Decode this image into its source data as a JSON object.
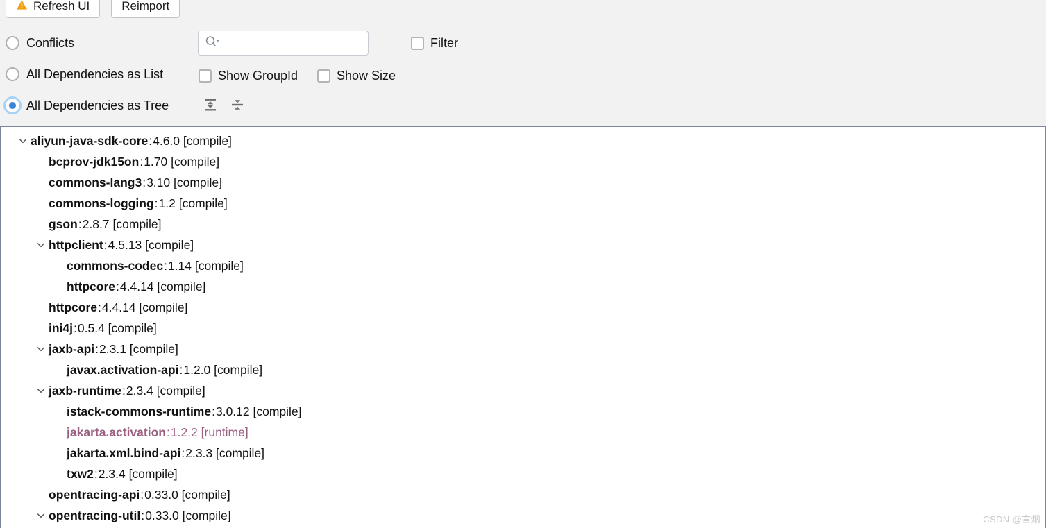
{
  "toolbar": {
    "buttons": [
      {
        "label": "Refresh UI",
        "icon": "warning-triangle-icon"
      },
      {
        "label": "Reimport",
        "icon": null
      }
    ],
    "radios": [
      {
        "label": "Conflicts",
        "selected": false
      },
      {
        "label": "All Dependencies as List",
        "selected": false
      },
      {
        "label": "All Dependencies as Tree",
        "selected": true
      }
    ],
    "checkboxes": [
      {
        "label": "Filter",
        "checked": false
      },
      {
        "label": "Show GroupId",
        "checked": false
      },
      {
        "label": "Show Size",
        "checked": false
      }
    ],
    "search": {
      "value": "",
      "placeholder": "",
      "icon": "search-icon",
      "dropdown_icon": "caret-down-icon"
    },
    "tree_actions": [
      {
        "name": "expand-all",
        "tooltip": "Expand All"
      },
      {
        "name": "collapse-all",
        "tooltip": "Collapse All"
      }
    ]
  },
  "colors": {
    "accent_selected": "#3a86d4",
    "warning": "#f0a010",
    "runtime_scope": "#9b5f82",
    "toolbar_bg": "#f2f2f2",
    "panel_border": "#7a8699"
  },
  "tree": {
    "rows": [
      {
        "depth": 0,
        "expandable": true,
        "artifact": "aliyun-java-sdk-core",
        "version": "4.6.0",
        "scope": "[compile]",
        "runtime": false
      },
      {
        "depth": 1,
        "expandable": false,
        "artifact": "bcprov-jdk15on",
        "version": "1.70",
        "scope": "[compile]",
        "runtime": false
      },
      {
        "depth": 1,
        "expandable": false,
        "artifact": "commons-lang3",
        "version": "3.10",
        "scope": "[compile]",
        "runtime": false
      },
      {
        "depth": 1,
        "expandable": false,
        "artifact": "commons-logging",
        "version": "1.2",
        "scope": "[compile]",
        "runtime": false
      },
      {
        "depth": 1,
        "expandable": false,
        "artifact": "gson",
        "version": "2.8.7",
        "scope": "[compile]",
        "runtime": false
      },
      {
        "depth": 1,
        "expandable": true,
        "artifact": "httpclient",
        "version": "4.5.13",
        "scope": "[compile]",
        "runtime": false
      },
      {
        "depth": 2,
        "expandable": false,
        "artifact": "commons-codec",
        "version": "1.14",
        "scope": "[compile]",
        "runtime": false
      },
      {
        "depth": 2,
        "expandable": false,
        "artifact": "httpcore",
        "version": "4.4.14",
        "scope": "[compile]",
        "runtime": false
      },
      {
        "depth": 1,
        "expandable": false,
        "artifact": "httpcore",
        "version": "4.4.14",
        "scope": "[compile]",
        "runtime": false
      },
      {
        "depth": 1,
        "expandable": false,
        "artifact": "ini4j",
        "version": "0.5.4",
        "scope": "[compile]",
        "runtime": false
      },
      {
        "depth": 1,
        "expandable": true,
        "artifact": "jaxb-api",
        "version": "2.3.1",
        "scope": "[compile]",
        "runtime": false
      },
      {
        "depth": 2,
        "expandable": false,
        "artifact": "javax.activation-api",
        "version": "1.2.0",
        "scope": "[compile]",
        "runtime": false
      },
      {
        "depth": 1,
        "expandable": true,
        "artifact": "jaxb-runtime",
        "version": "2.3.4",
        "scope": "[compile]",
        "runtime": false
      },
      {
        "depth": 2,
        "expandable": false,
        "artifact": "istack-commons-runtime",
        "version": "3.0.12",
        "scope": "[compile]",
        "runtime": false
      },
      {
        "depth": 2,
        "expandable": false,
        "artifact": "jakarta.activation",
        "version": "1.2.2",
        "scope": "[runtime]",
        "runtime": true
      },
      {
        "depth": 2,
        "expandable": false,
        "artifact": "jakarta.xml.bind-api",
        "version": "2.3.3",
        "scope": "[compile]",
        "runtime": false
      },
      {
        "depth": 2,
        "expandable": false,
        "artifact": "txw2",
        "version": "2.3.4",
        "scope": "[compile]",
        "runtime": false
      },
      {
        "depth": 1,
        "expandable": false,
        "artifact": "opentracing-api",
        "version": "0.33.0",
        "scope": "[compile]",
        "runtime": false
      },
      {
        "depth": 1,
        "expandable": true,
        "artifact": "opentracing-util",
        "version": "0.33.0",
        "scope": "[compile]",
        "runtime": false
      }
    ]
  },
  "watermark": {
    "text": "CSDN @言烟"
  }
}
